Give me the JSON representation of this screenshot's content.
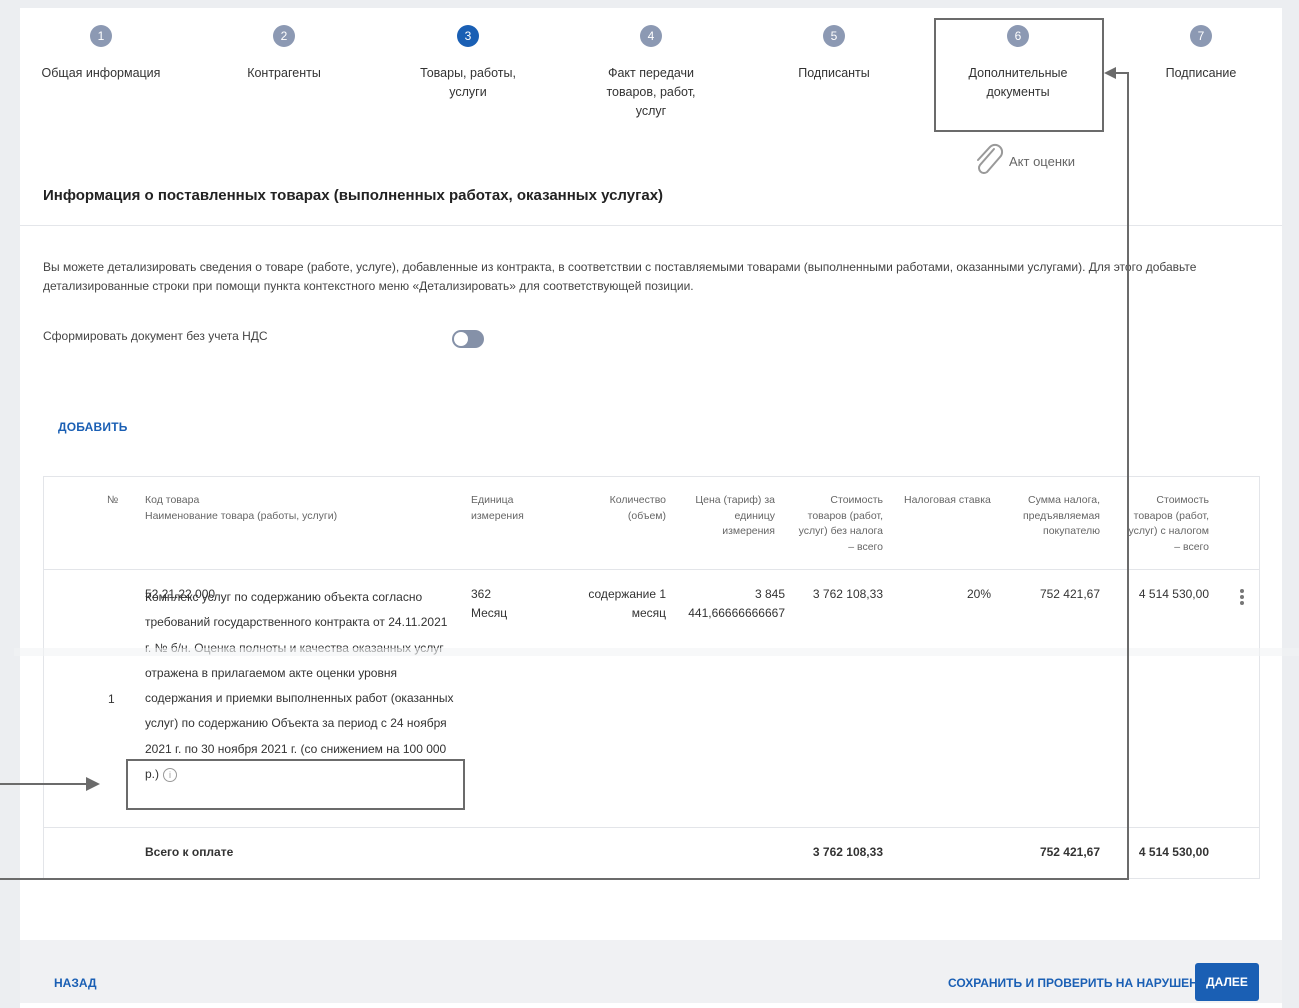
{
  "stepper": {
    "steps": [
      {
        "num": "1",
        "label": "Общая информация"
      },
      {
        "num": "2",
        "label": "Контрагенты"
      },
      {
        "num": "3",
        "label": "Товары, работы,\nуслуги"
      },
      {
        "num": "4",
        "label": "Факт передачи\nтоваров, работ,\nуслуг"
      },
      {
        "num": "5",
        "label": "Подписанты"
      },
      {
        "num": "6",
        "label": "Дополнительные\nдокументы"
      },
      {
        "num": "7",
        "label": "Подписание"
      }
    ],
    "active_step": "3"
  },
  "attachment": {
    "label": "Акт оценки",
    "icon": "paperclip-icon"
  },
  "section": {
    "title": "Информация о поставленных товарах (выполненных работах, оказанных услугах)",
    "info": "Вы можете детализировать сведения о товаре (работе, услуге), добавленные из контракта, в соответствии с поставляемыми товарами (выполненными работами, оказанными услугами). Для этого добавьте детализированные строки при помощи пункта контекстного меню «Детализировать» для соответствующей позиции."
  },
  "vat_toggle": {
    "label": "Сформировать документ без учета НДС",
    "state": "off"
  },
  "add_button": "ДОБАВИТЬ",
  "table": {
    "headers": {
      "no": "№",
      "code_name": "Код товара\nНаименование товара (работы, услуги)",
      "unit": "Единица\nизмерения",
      "qty": "Количество\n(объем)",
      "price": "Цена (тариф) за\nединицу\nизмерения",
      "cost_no_tax": "Стоимость\nтоваров (работ,\nуслуг) без налога\n– всего",
      "tax_rate": "Налоговая ставка",
      "tax_sum": "Сумма налога,\nпредъявляемая\nпокупателю",
      "cost_with_tax": "Стоимость\nтоваров (работ,\nуслуг) с налогом\n– всего"
    },
    "row": {
      "no": "1",
      "code": "52.21.22.000",
      "name": "Комплекс услуг по содержанию объекта согласно требований государственного контракта от 24.11.2021 г. № б/н. Оценка полноты и качества оказанных услуг отражена в прилагаемом акте оценки уровня содержания и приемки выполненных работ (оказанных услуг) по содержанию Объекта за период с 24 ноября 2021 г. по 30 ноября 2021 г. (со снижением на 100 000 р.)",
      "unit_code": "362",
      "unit_name": "Месяц",
      "qty": "содержание 1\nмесяц",
      "price": "3 845\n441,66666666667",
      "cost_no_tax": "3 762 108,33",
      "tax_rate": "20%",
      "tax_sum": "752 421,67",
      "cost_with_tax": "4 514 530,00"
    },
    "total": {
      "label": "Всего к оплате",
      "cost_no_tax": "3 762 108,33",
      "tax_sum": "752 421,67",
      "cost_with_tax": "4 514 530,00"
    }
  },
  "footer": {
    "back": "НАЗАД",
    "save_check": "СОХРАНИТЬ И ПРОВЕРИТЬ НА НАРУШЕНИЯ",
    "next": "ДАЛЕЕ"
  },
  "colors": {
    "accent": "#1a5fb4",
    "step_inactive": "#8c99b3",
    "highlight": "#6b6b6b"
  }
}
